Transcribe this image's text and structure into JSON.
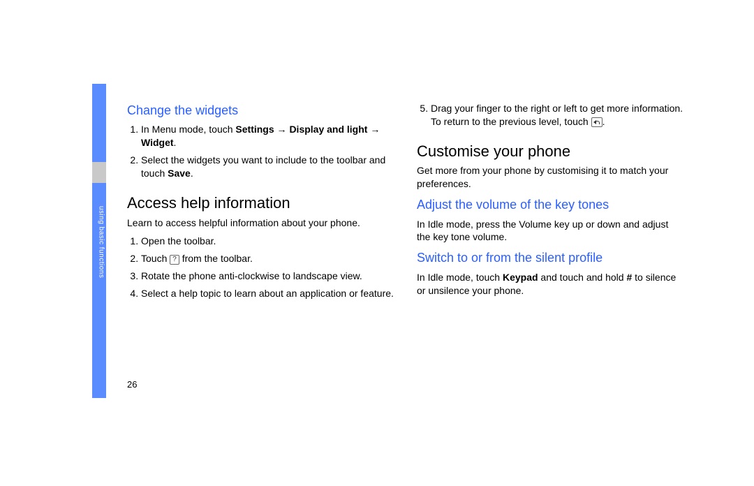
{
  "page_number": "26",
  "side_label": "using basic functions",
  "left": {
    "h_widgets": "Change the widgets",
    "widgets_steps": [
      {
        "pre": "In Menu mode, touch ",
        "bold1": "Settings",
        "mid1": " → ",
        "bold2": "Display and light",
        "mid2": " → ",
        "bold3": "Widget",
        "post": "."
      },
      {
        "pre": "Select the widgets you want to include to the toolbar and touch ",
        "bold1": "Save",
        "post": "."
      }
    ],
    "h_help": "Access help information",
    "help_intro": "Learn to access helpful information about your phone.",
    "help_steps": [
      "Open the toolbar.",
      "__TOUCH_ICON__",
      "Rotate the phone anti-clockwise to landscape view.",
      "Select a help topic to learn about an application or feature."
    ],
    "help_step2_pre": "Touch ",
    "help_step2_post": " from the toolbar.",
    "help_icon_glyph": "?"
  },
  "right": {
    "step5_pre": "Drag your finger to the right or left to get more information. To return to the previous level, touch ",
    "step5_post": ".",
    "h_customise": "Customise your phone",
    "customise_intro": "Get more from your phone by customising it to match your preferences.",
    "h_volume": "Adjust the volume of the key tones",
    "volume_body": "In Idle mode, press the Volume key up or down and adjust the key tone volume.",
    "h_silent": "Switch to or from the silent profile",
    "silent_pre": "In Idle mode, touch ",
    "silent_bold": "Keypad",
    "silent_mid": " and touch and hold ",
    "silent_hash": "#",
    "silent_post": " to silence or unsilence your phone."
  }
}
